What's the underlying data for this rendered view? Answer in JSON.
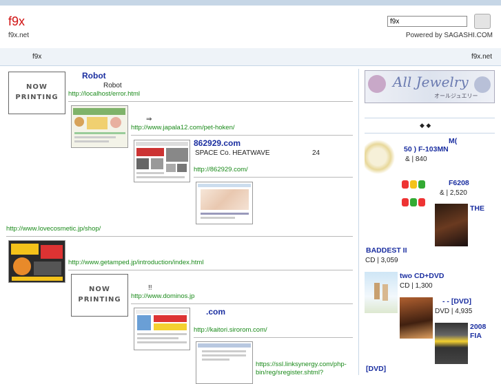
{
  "header": {
    "site_title": "f9x",
    "site_url": "f9x.net",
    "search_value": "f9x",
    "powered_by": "Powered by SAGASHI.COM"
  },
  "nav": {
    "left": "f9x",
    "right": "f9x.net"
  },
  "now_printing": {
    "line1": "NOW",
    "line2": "PRINTING"
  },
  "results": {
    "r1": {
      "title": "Robot",
      "desc": "Robot",
      "url": "http://localhost/error.html"
    },
    "r2": {
      "arrow": "⇒",
      "url": "http://www.japala12.com/pet-hoken/"
    },
    "r3": {
      "title": "862929.com",
      "desc": "SPACE Co.   HEATWAVE",
      "extra": "24",
      "url": "http://862929.com/"
    },
    "r4": {
      "url": "http://www.lovecosmetic.jp/shop/"
    },
    "r5": {
      "url": "http://www.getamped.jp/introduction/index.html"
    },
    "r6": {
      "desc": "!!",
      "url": "http://www.dominos.jp"
    },
    "r7": {
      "title": ".com",
      "url": "http://kaitori.sirorom.com/"
    },
    "r8": {
      "url1": "https://ssl.linksynergy.com/php-",
      "url2": "bin/reg/sregister.shtml?"
    }
  },
  "sidebar": {
    "banner_text": "All Jewelry",
    "banner_sub": "オールジュエリー",
    "diamonds": "◆    ◆",
    "items": [
      {
        "t1": "M(",
        "t2": "50    ) F-103MN",
        "price": "&    | 840"
      },
      {
        "t1": "F6208",
        "price": "&    | 2,520"
      },
      {
        "t1": "THE",
        "t2": "BADDEST II",
        "price": "CD | 3,059"
      },
      {
        "t1": "two           CD+DVD",
        "price": "CD | 1,300"
      },
      {
        "t1": "-    - [DVD]",
        "price": "DVD | 4,935"
      },
      {
        "t1": "2008",
        "t2": "FIA",
        "t3": "[DVD]"
      }
    ]
  }
}
